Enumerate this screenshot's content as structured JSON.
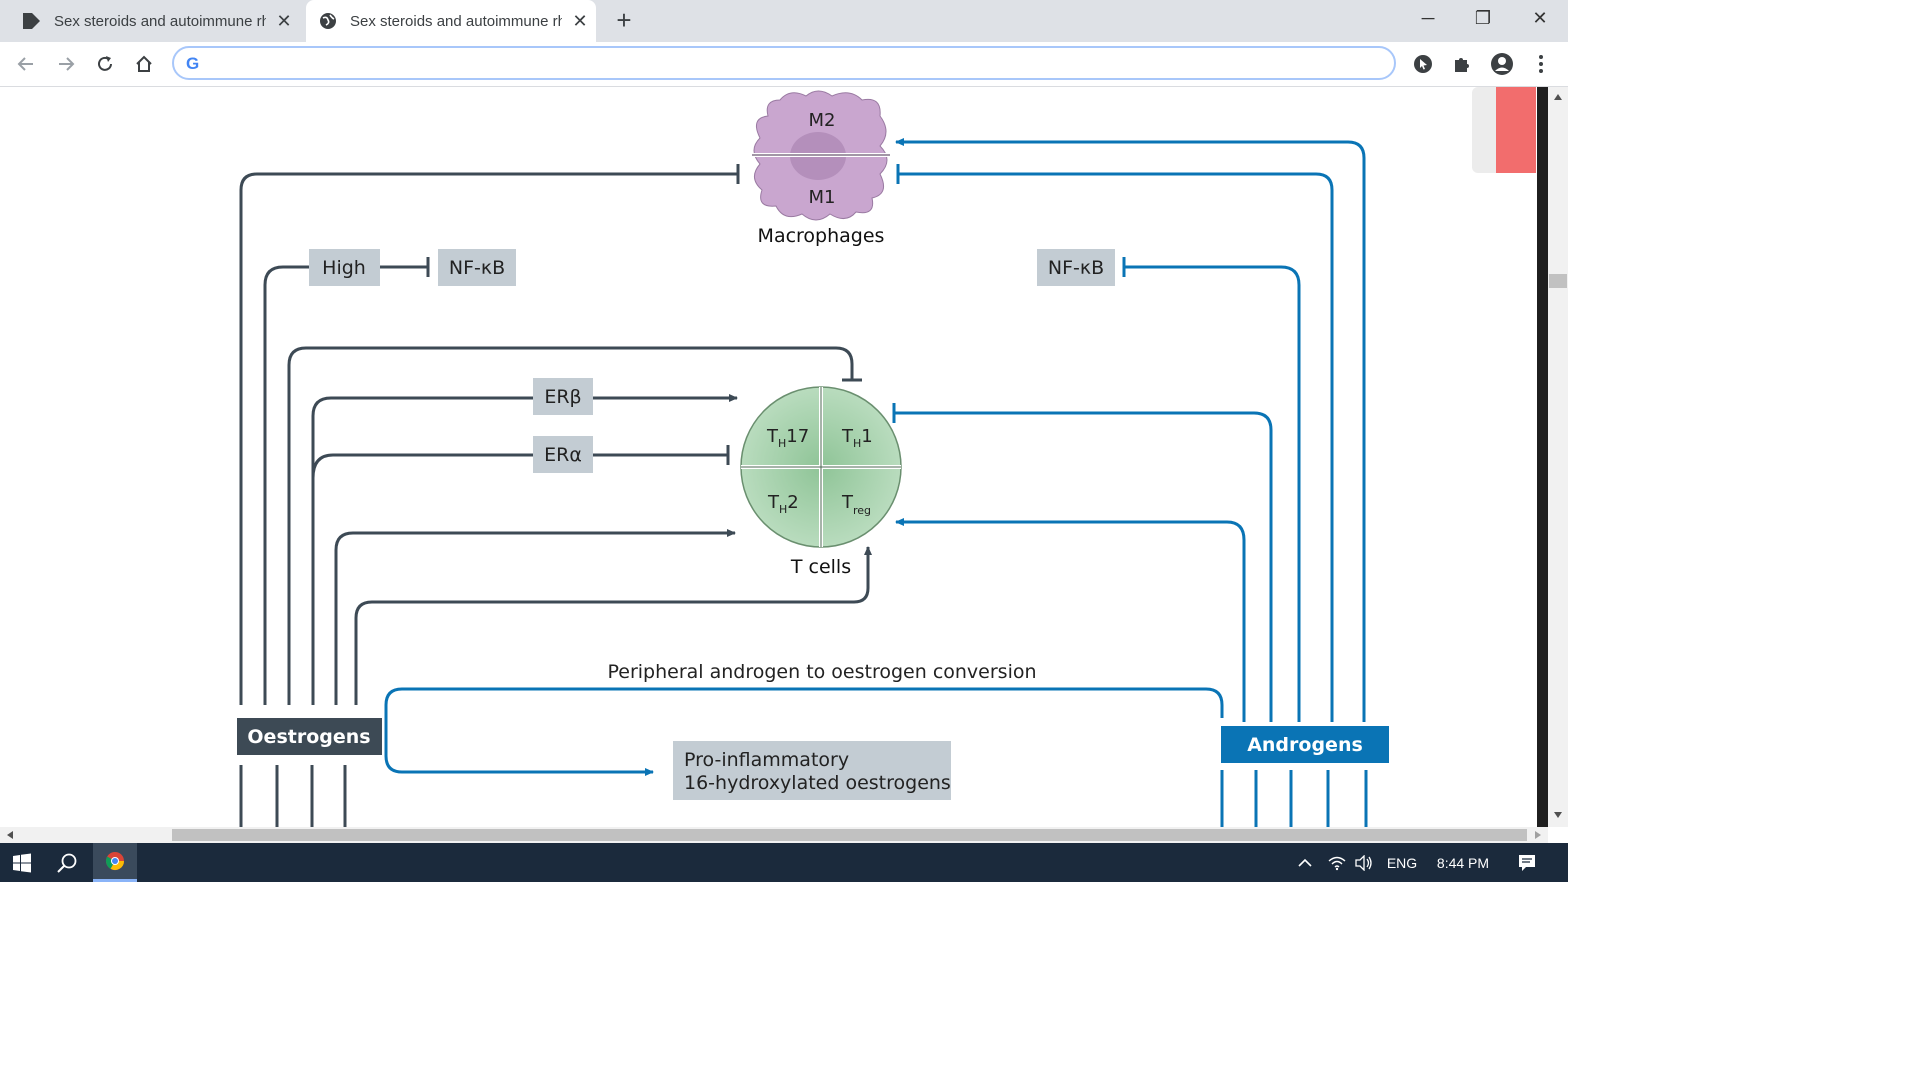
{
  "browser": {
    "tabs": [
      {
        "title": "Sex steroids and autoimmune rheumatic diseases",
        "icon": "document-icon",
        "active": false
      },
      {
        "title": "Sex steroids and autoimmune rheumatic diseases",
        "icon": "globe-icon",
        "active": true
      }
    ],
    "address": {
      "value": "",
      "placeholder": ""
    }
  },
  "diagram": {
    "macrophages": {
      "label": "Macrophages",
      "m2": "M2",
      "m1": "M1"
    },
    "tcells": {
      "label": "T cells",
      "th17_main": "T",
      "th17_sub": "H",
      "th17_suffix": "17",
      "th1_main": "T",
      "th1_sub": "H",
      "th1_suffix": "1",
      "th2_main": "T",
      "th2_sub": "H",
      "th2_suffix": "2",
      "treg_main": "T",
      "treg_sub": "reg"
    },
    "high": "High",
    "nfkb_left": "NF-κB",
    "nfkb_right": "NF-κB",
    "erb": "ERβ",
    "era": "ERα",
    "oestrogens": "Oestrogens",
    "androgens": "Androgens",
    "conversion": "Peripheral androgen to oestrogen conversion",
    "proinflammatory_line1": "Pro-inflammatory",
    "proinflammatory_line2": "16-hydroxylated oestrogens",
    "colors": {
      "oestrogen_line": "#3d4a55",
      "androgen_line": "#0a74b5",
      "label_box": "#c3ccd3",
      "oestrogen_box": "#3d4a55",
      "androgen_box": "#0a74b5",
      "macrophage": "#c9a6cf",
      "tcell": "#a6d2ac"
    }
  },
  "taskbar": {
    "language": "ENG",
    "time": "8:44 PM"
  }
}
